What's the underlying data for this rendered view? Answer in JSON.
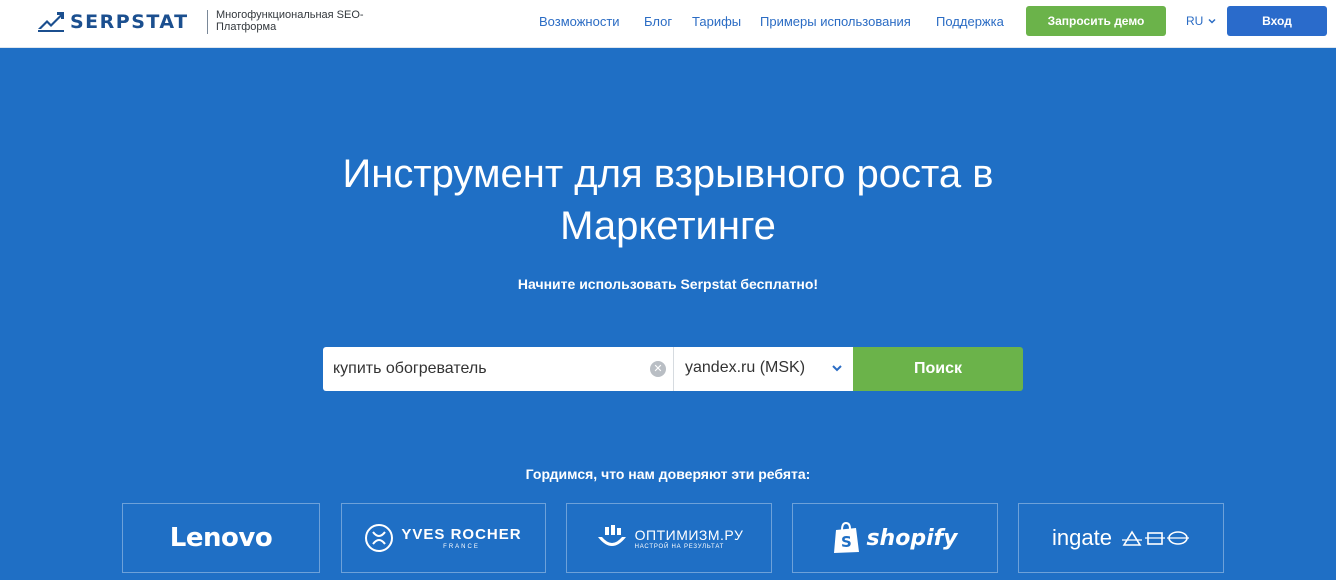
{
  "header": {
    "logo_text": "SERPSTAT",
    "tagline": "Многофункциональная SEO-Платформа",
    "nav": [
      {
        "label": "Возможности"
      },
      {
        "label": "Блог"
      },
      {
        "label": "Тарифы"
      },
      {
        "label": "Примеры использования"
      },
      {
        "label": "Поддержка"
      }
    ],
    "demo_button": "Запросить демо",
    "language": "RU",
    "login_button": "Вход"
  },
  "hero": {
    "title": "Инструмент для взрывного роста в Маркетинге",
    "subtitle": "Начните использовать Serpstat бесплатно!"
  },
  "search": {
    "query": "купить обогреватель",
    "database": "yandex.ru (MSK)",
    "submit_label": "Поиск"
  },
  "trust": {
    "text": "Гордимся, что нам доверяют эти ребята:",
    "logos": [
      {
        "name": "Lenovo"
      },
      {
        "name": "YVES ROCHER",
        "sub": "FRANCE"
      },
      {
        "name": "ОПТИМИЗМ.РУ",
        "sub": "НАСТРОЙ НА РЕЗУЛЬТАТ"
      },
      {
        "name": "shopify"
      },
      {
        "name": "ingate"
      }
    ]
  },
  "colors": {
    "background": "#1f6fc5",
    "accent_green": "#6bb34a",
    "login_blue": "#2a6bcb",
    "nav_link": "#2b6cc4"
  }
}
